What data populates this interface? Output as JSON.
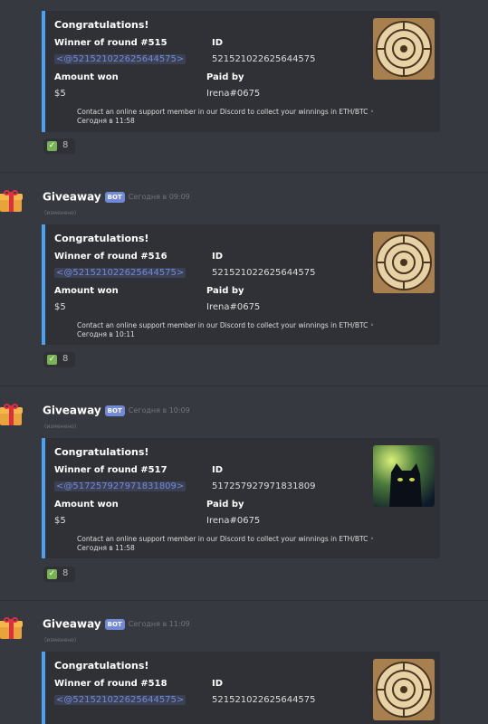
{
  "messages": [
    {
      "header": null,
      "embed": {
        "title": "Congratulations!",
        "winner_label": "Winner of round #515",
        "winner_mention": "<@521521022625644575>",
        "id_label": "ID",
        "id_value": "521521022625644575",
        "amount_label": "Amount won",
        "amount_value": "$5",
        "paid_label": "Paid by",
        "paid_value": "Irena#0675",
        "footer_text": "Contact an online support member in our Discord to collect your winnings in ETH/BTC",
        "footer_dot": "•",
        "footer_time": "Сегодня в 11:58",
        "thumbnail": "spiral-clock"
      },
      "reaction": {
        "emoji": "white-check-mark",
        "count": "8"
      }
    },
    {
      "header": {
        "username": "Giveaway",
        "bot_tag": "BOT",
        "timestamp": "Сегодня в 09:09",
        "edited": "(изменено)",
        "avatar": "gift-icon"
      },
      "embed": {
        "title": "Congratulations!",
        "winner_label": "Winner of round #516",
        "winner_mention": "<@521521022625644575>",
        "id_label": "ID",
        "id_value": "521521022625644575",
        "amount_label": "Amount won",
        "amount_value": "$5",
        "paid_label": "Paid by",
        "paid_value": "Irena#0675",
        "footer_text": "Contact an online support member in our Discord to collect your winnings in ETH/BTC",
        "footer_dot": "•",
        "footer_time": "Сегодня в 10:11",
        "thumbnail": "spiral-clock"
      },
      "reaction": {
        "emoji": "white-check-mark",
        "count": "8"
      }
    },
    {
      "header": {
        "username": "Giveaway",
        "bot_tag": "BOT",
        "timestamp": "Сегодня в 10:09",
        "edited": "(изменено)",
        "avatar": "gift-icon"
      },
      "embed": {
        "title": "Congratulations!",
        "winner_label": "Winner of round #517",
        "winner_mention": "<@517257927971831809>",
        "id_label": "ID",
        "id_value": "517257927971831809",
        "amount_label": "Amount won",
        "amount_value": "$5",
        "paid_label": "Paid by",
        "paid_value": "Irena#0675",
        "footer_text": "Contact an online support member in our Discord to collect your winnings in ETH/BTC",
        "footer_dot": "•",
        "footer_time": "Сегодня в 11:58",
        "thumbnail": "black-cat"
      },
      "reaction": {
        "emoji": "white-check-mark",
        "count": "8"
      }
    },
    {
      "header": {
        "username": "Giveaway",
        "bot_tag": "BOT",
        "timestamp": "Сегодня в 11:09",
        "edited": "(изменено)",
        "avatar": "gift-icon"
      },
      "embed": {
        "title": "Congratulations!",
        "winner_label": "Winner of round #518",
        "winner_mention": "<@521521022625644575>",
        "id_label": "ID",
        "id_value": "521521022625644575",
        "thumbnail": "spiral-clock"
      },
      "reaction": null
    }
  ],
  "colors": {
    "background": "#36393f",
    "embed_bg": "#2f3136",
    "embed_border": "#4ea0ef",
    "mention": "#7289da",
    "bot_tag": "#7289da",
    "check": "#77b255"
  }
}
